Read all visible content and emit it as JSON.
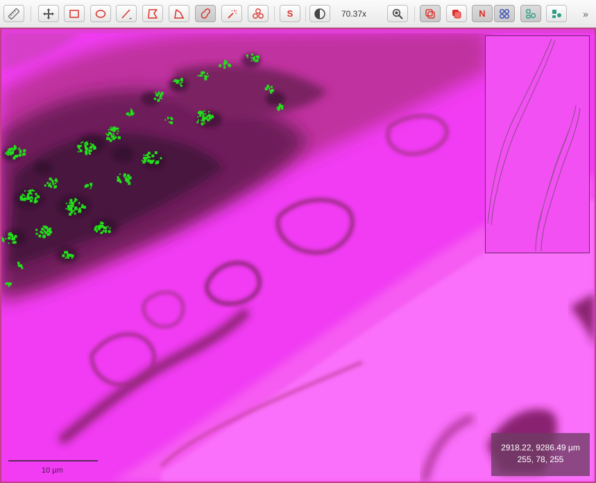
{
  "toolbar": {
    "zoom_level": "70.37x",
    "tools": [
      {
        "icon": "ruler-icon"
      },
      {
        "icon": "move-icon"
      },
      {
        "icon": "rectangle-icon"
      },
      {
        "icon": "ellipse-icon"
      },
      {
        "icon": "line-icon"
      },
      {
        "icon": "polygon-icon"
      },
      {
        "icon": "polyline-icon"
      },
      {
        "icon": "freehand-icon"
      },
      {
        "icon": "magic-wand-icon"
      },
      {
        "icon": "cells-icon"
      },
      {
        "icon": "s-icon",
        "text": "S"
      },
      {
        "icon": "contrast-icon"
      },
      {
        "icon": "zoom-icon"
      },
      {
        "icon": "overlay-toggle-icon"
      },
      {
        "icon": "fill-overlay-icon"
      },
      {
        "icon": "n-icon",
        "text": "N"
      },
      {
        "icon": "nuclei-icon"
      },
      {
        "icon": "layers-icon"
      },
      {
        "icon": "clusters-icon"
      }
    ],
    "more_label": "»"
  },
  "viewer": {
    "scale_bar_label": "10 µm",
    "coordinates": "2918.22, 9286.49 µm",
    "pixel_value": "255, 78, 255"
  },
  "colors": {
    "tissue_background": "#f13cf3",
    "stroma": "#7a1f5c",
    "nuclei_highlight": "#22e01a",
    "accent_red": "#d9302a",
    "accent_teal": "#2f9e86",
    "accent_blue": "#3b4fb5"
  }
}
